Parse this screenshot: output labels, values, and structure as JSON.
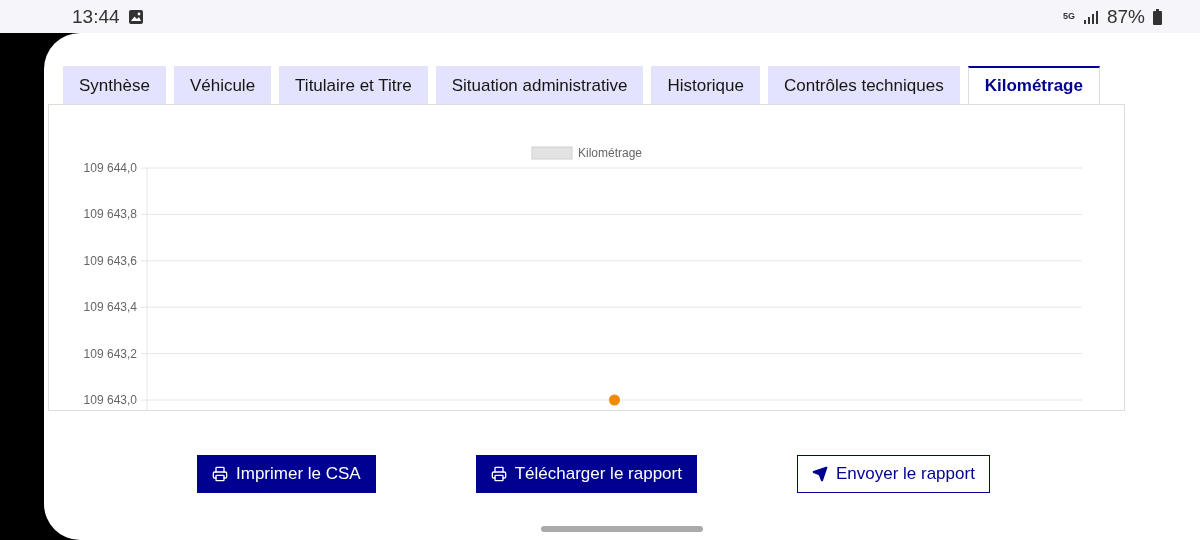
{
  "status_bar": {
    "time": "13:44",
    "network": "5G",
    "battery": "87%"
  },
  "tabs": [
    {
      "label": "Synthèse",
      "selected": false
    },
    {
      "label": "Véhicule",
      "selected": false
    },
    {
      "label": "Titulaire et Titre",
      "selected": false
    },
    {
      "label": "Situation administrative",
      "selected": false
    },
    {
      "label": "Historique",
      "selected": false
    },
    {
      "label": "Contrôles techniques",
      "selected": false
    },
    {
      "label": "Kilométrage",
      "selected": true
    }
  ],
  "chart": {
    "chart_data": {
      "type": "scatter",
      "ylim": [
        109643.0,
        109644.0
      ],
      "yticks": [
        {
          "value": 109643.0,
          "label": "109 643,0"
        },
        {
          "value": 109643.2,
          "label": "109 643,2"
        },
        {
          "value": 109643.4,
          "label": "109 643,4"
        },
        {
          "value": 109643.6,
          "label": "109 643,6"
        },
        {
          "value": 109643.8,
          "label": "109 643,8"
        },
        {
          "value": 109644.0,
          "label": "109 644,0"
        }
      ],
      "grid": true,
      "series": [
        {
          "name": "Kilométrage",
          "color": "#f08a00",
          "values": [
            109643.0
          ]
        }
      ]
    }
  },
  "actions": [
    {
      "label": "Imprimer le CSA",
      "kind": "print",
      "primary": true
    },
    {
      "label": "Télécharger le rapport",
      "kind": "print",
      "primary": true
    },
    {
      "label": "Envoyer le rapport",
      "kind": "send",
      "primary": false
    }
  ]
}
